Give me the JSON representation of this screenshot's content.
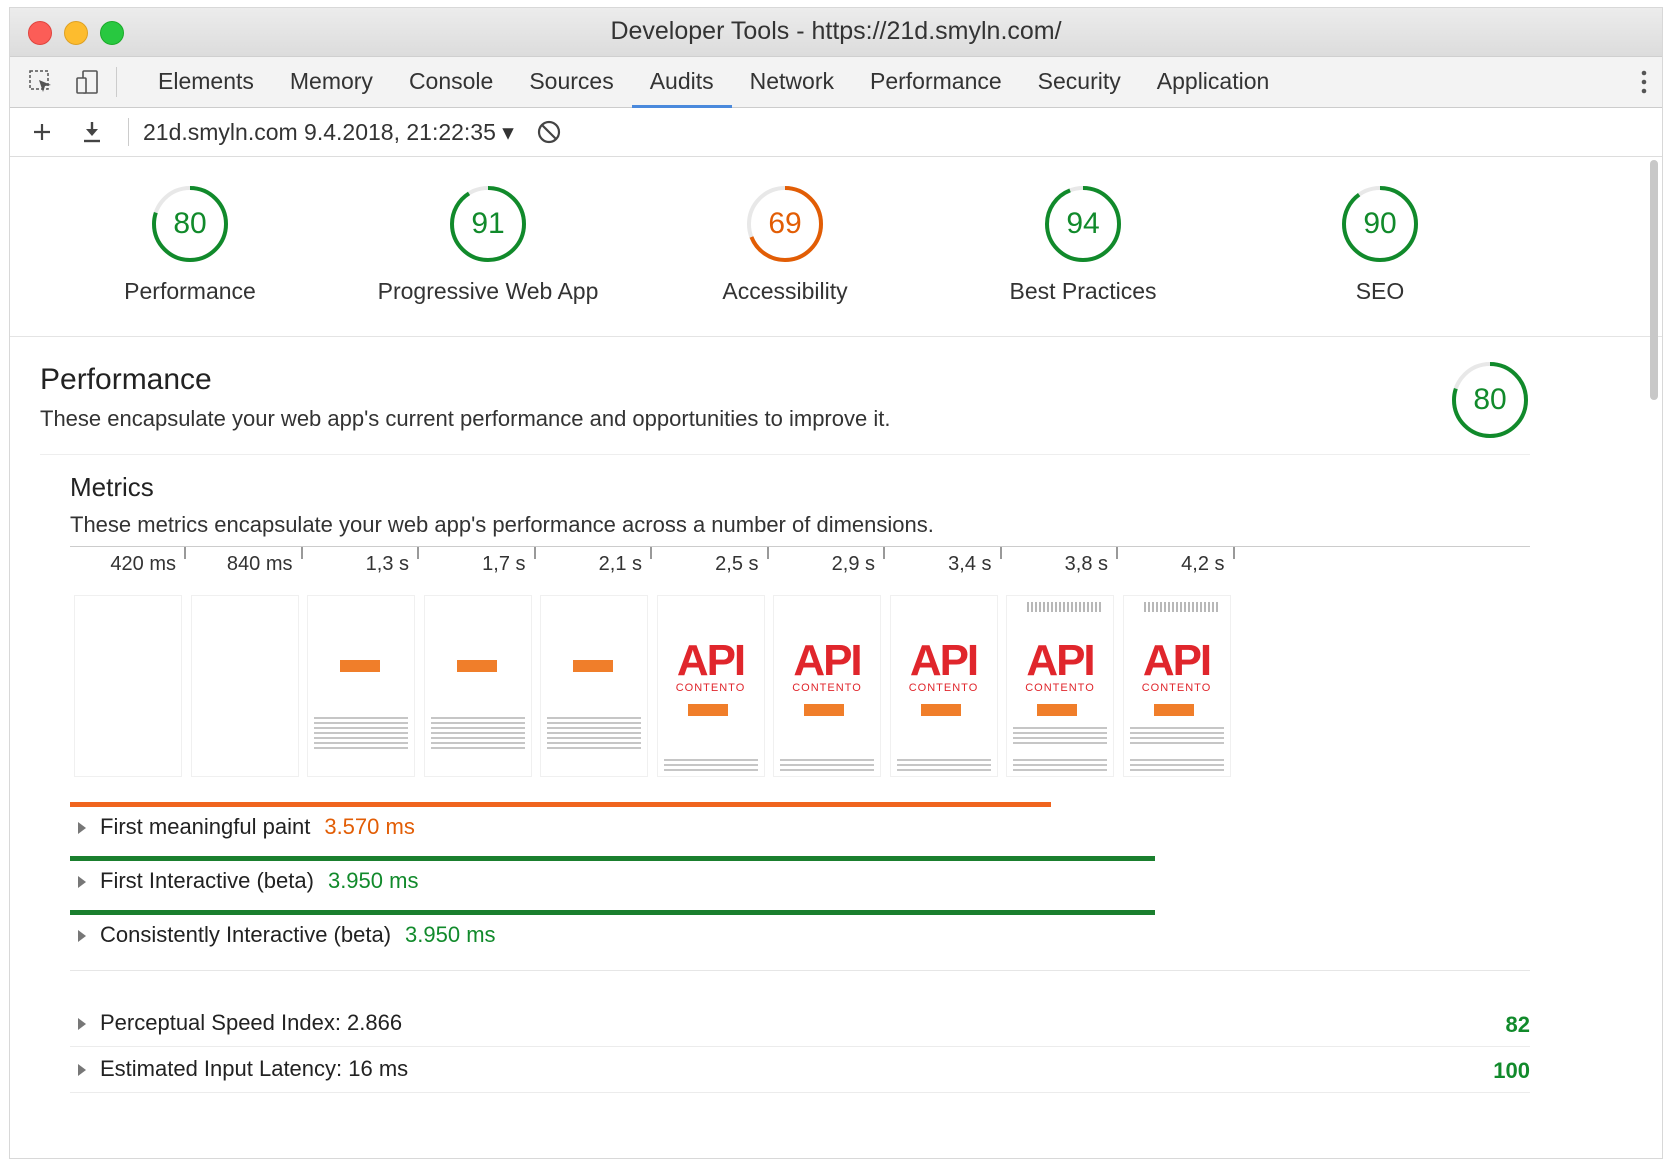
{
  "window": {
    "title": "Developer Tools - https://21d.smyln.com/"
  },
  "tabs": [
    "Elements",
    "Memory",
    "Console",
    "Sources",
    "Audits",
    "Network",
    "Performance",
    "Security",
    "Application"
  ],
  "active_tab": "Audits",
  "toolbar": {
    "report": "21d.smyln.com 9.4.2018, 21:22:35 ▾"
  },
  "categories": [
    {
      "score": "80",
      "label": "Performance",
      "color": "#118a2b",
      "fraction": 0.8
    },
    {
      "score": "91",
      "label": "Progressive Web App",
      "color": "#118a2b",
      "fraction": 0.91
    },
    {
      "score": "69",
      "label": "Accessibility",
      "color": "#e25d05",
      "fraction": 0.69
    },
    {
      "score": "94",
      "label": "Best Practices",
      "color": "#118a2b",
      "fraction": 0.94
    },
    {
      "score": "90",
      "label": "SEO",
      "color": "#118a2b",
      "fraction": 0.9
    }
  ],
  "performance": {
    "title": "Performance",
    "description": "These encapsulate your web app's current performance and opportunities to improve it.",
    "score": "80",
    "score_fraction": 0.8
  },
  "metrics": {
    "title": "Metrics",
    "description": "These metrics encapsulate your web app's performance across a number of dimensions.",
    "filmstrip": [
      {
        "time": "420 ms",
        "content": "blank"
      },
      {
        "time": "840 ms",
        "content": "blank"
      },
      {
        "time": "1,3 s",
        "content": "loading"
      },
      {
        "time": "1,7 s",
        "content": "loading"
      },
      {
        "time": "2,1 s",
        "content": "loading"
      },
      {
        "time": "2,5 s",
        "content": "api"
      },
      {
        "time": "2,9 s",
        "content": "api"
      },
      {
        "time": "3,4 s",
        "content": "api"
      },
      {
        "time": "3,8 s",
        "content": "api-full"
      },
      {
        "time": "4,2 s",
        "content": "api-full"
      }
    ],
    "api_logo_text": "API",
    "api_logo_sub": "CONTENTO",
    "timeline": [
      {
        "label": "First meaningful paint",
        "value": "3.570 ms",
        "color": "#f0641e",
        "text_color": "#e25d05",
        "fraction": 0.672
      },
      {
        "label": "First Interactive (beta)",
        "value": "3.950 ms",
        "color": "#1a7f2e",
        "text_color": "#118a2b",
        "fraction": 0.743
      },
      {
        "label": "Consistently Interactive (beta)",
        "value": "3.950 ms",
        "color": "#1a7f2e",
        "text_color": "#118a2b",
        "fraction": 0.743
      }
    ]
  },
  "opportunities": [
    {
      "label": "Perceptual Speed Index: 2.866",
      "score": "82"
    },
    {
      "label": "Estimated Input Latency: 16 ms",
      "score": "100"
    }
  ]
}
